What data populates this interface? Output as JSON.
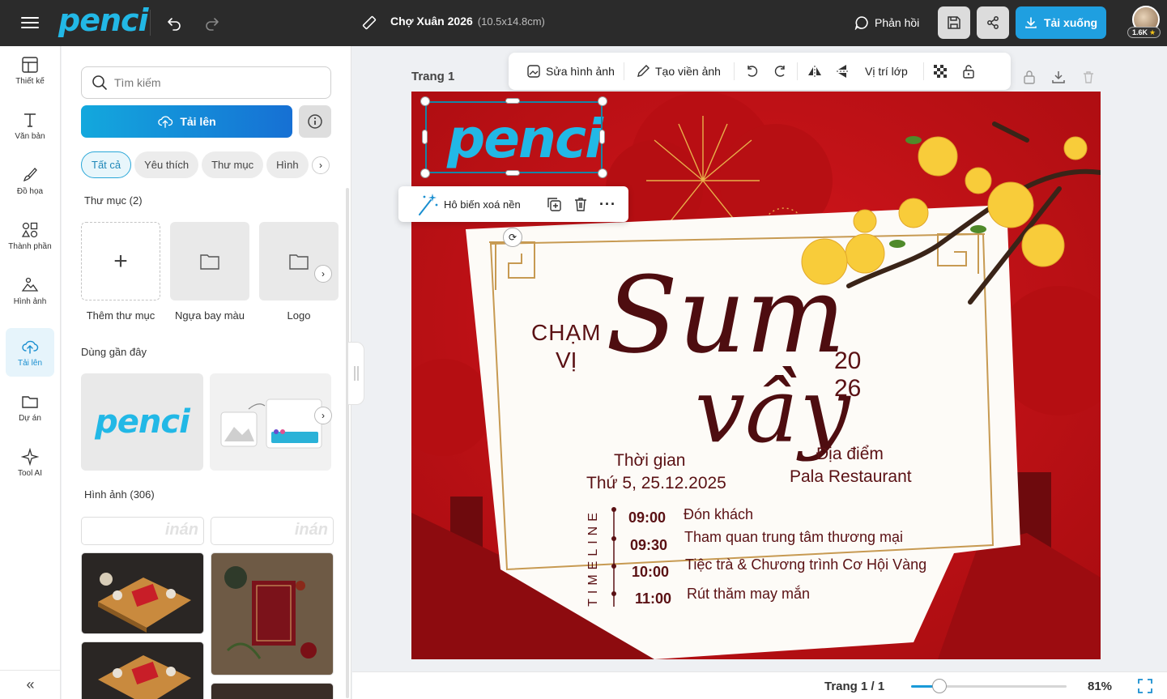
{
  "app": {
    "logo": "penci",
    "doc_title": "Chợ Xuân 2026",
    "doc_size": "(10.5x14.8cm)"
  },
  "topbar": {
    "feedback_label": "Phản hồi",
    "download_label": "Tải xuống",
    "badge": "1.6K"
  },
  "rail": {
    "items": [
      {
        "label": "Thiết kế"
      },
      {
        "label": "Văn bản"
      },
      {
        "label": "Đồ họa"
      },
      {
        "label": "Thành phần"
      },
      {
        "label": "Hình ảnh"
      },
      {
        "label": "Tải lên"
      },
      {
        "label": "Dự án"
      },
      {
        "label": "Tool AI"
      }
    ],
    "collapse": "«"
  },
  "panel": {
    "search_placeholder": "Tìm kiếm",
    "upload_label": "Tải lên",
    "chips": [
      "Tất cả",
      "Yêu thích",
      "Thư mục",
      "Hình"
    ],
    "folders_title": "Thư mục (2)",
    "folders": [
      "Thêm thư mục",
      "Ngựa bay màu",
      "Logo"
    ],
    "recent_title": "Dùng gần đây",
    "recent_logo": "penci",
    "images_title": "Hình ảnh (306)",
    "watermark": "inán"
  },
  "canvas": {
    "page_label": "Trang 1",
    "toolbar": {
      "edit_image": "Sửa hình ảnh",
      "frame": "Tạo viền ảnh",
      "layer": "Vị trí lớp"
    },
    "context_menu": {
      "remove_bg": "Hô biến xoá nền"
    },
    "design": {
      "logo": "penci",
      "cham": "CHẠM",
      "vi": "VỊ",
      "script_1": "Sum",
      "script_2": "vầy",
      "year_1": "20",
      "year_2": "26",
      "time_title": "Thời gian",
      "time_value": "Thứ 5, 25.12.2025",
      "place_title": "Địa điểm",
      "place_value": "Pala Restaurant",
      "timeline_label": "TIMELINE",
      "schedule": [
        {
          "time": "09:00",
          "event": "Đón khách"
        },
        {
          "time": "09:30",
          "event": "Tham quan trung tâm thương mại"
        },
        {
          "time": "10:00",
          "event": "Tiệc trà & Chương trình Cơ Hội Vàng"
        },
        {
          "time": "11:00",
          "event": "Rút thăm may mắn"
        }
      ]
    }
  },
  "bottombar": {
    "page_count": "Trang 1 / 1",
    "zoom": "81%",
    "zoom_fraction": 0.81
  },
  "colors": {
    "brand": "#22b8e6",
    "primary": "#1f9fe0",
    "design_red": "#c40f14",
    "ink": "#5a1114"
  }
}
